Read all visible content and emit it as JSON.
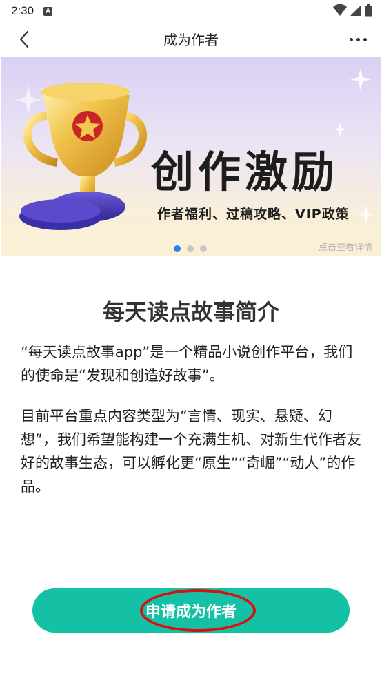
{
  "status_bar": {
    "time": "2:30",
    "notification_icon": "A"
  },
  "nav": {
    "title": "成为作者"
  },
  "banner": {
    "title": "创作激励",
    "subtitle": "作者福利、过稿攻略、VIP政策",
    "link_text": "点击查看详情",
    "page_count": 3,
    "active_page": 1
  },
  "intro": {
    "title": "每天读点故事简介",
    "paragraph1": "“每天读点故事app”是一个精品小说创作平台，我们的使命是“发现和创造好故事”。",
    "paragraph2": "目前平台重点内容类型为“言情、现实、悬疑、幻想”，我们希望能构建一个充满生机、对新生代作者友好的故事生态，可以孵化更“原生”“奇崛”“动人”的作品。"
  },
  "footer": {
    "apply_label": "申请成为作者"
  },
  "colors": {
    "accent": "#14c1a4",
    "highlight": "#d81010",
    "dot_active": "#2e7cf6"
  }
}
